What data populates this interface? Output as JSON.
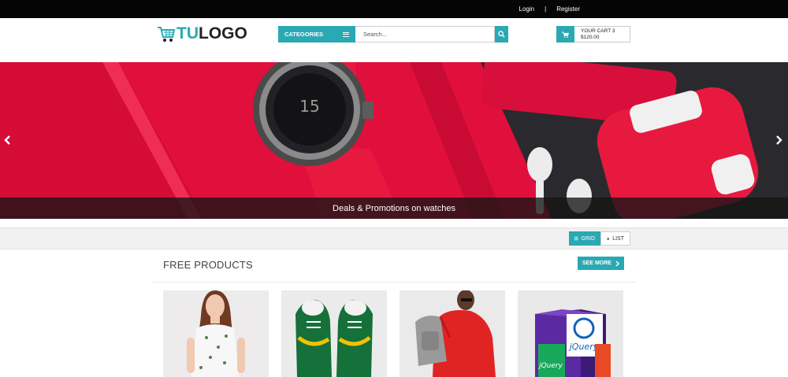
{
  "topbar": {
    "login": "Login",
    "separator": "|",
    "register": "Register"
  },
  "logo": {
    "prefix": "TU",
    "suffix": "LOGO",
    "icon": "shopping-cart-icon"
  },
  "search": {
    "categories_label": "CATEGORIES",
    "placeholder": "Search..."
  },
  "cart": {
    "label": "YOUR CART 3",
    "total": "$120.00"
  },
  "hero": {
    "caption": "Deals & Promotions on watches",
    "watch_number": "15"
  },
  "view_toggle": {
    "grid_label": "GRID",
    "list_label": "LIST",
    "active": "grid"
  },
  "section": {
    "title": "FREE PRODUCTS",
    "see_more": "SEE MORE"
  },
  "products": [
    {
      "name": "floral-dress",
      "icon": "product-image"
    },
    {
      "name": "green-sneakers",
      "icon": "product-image"
    },
    {
      "name": "red-jacket",
      "icon": "product-image"
    },
    {
      "name": "jquery-box",
      "icon": "product-image",
      "box_text": "jQuery"
    }
  ],
  "colors": {
    "accent": "#2aa9b3",
    "hero_red": "#e10f3c",
    "topbar": "#050505"
  }
}
